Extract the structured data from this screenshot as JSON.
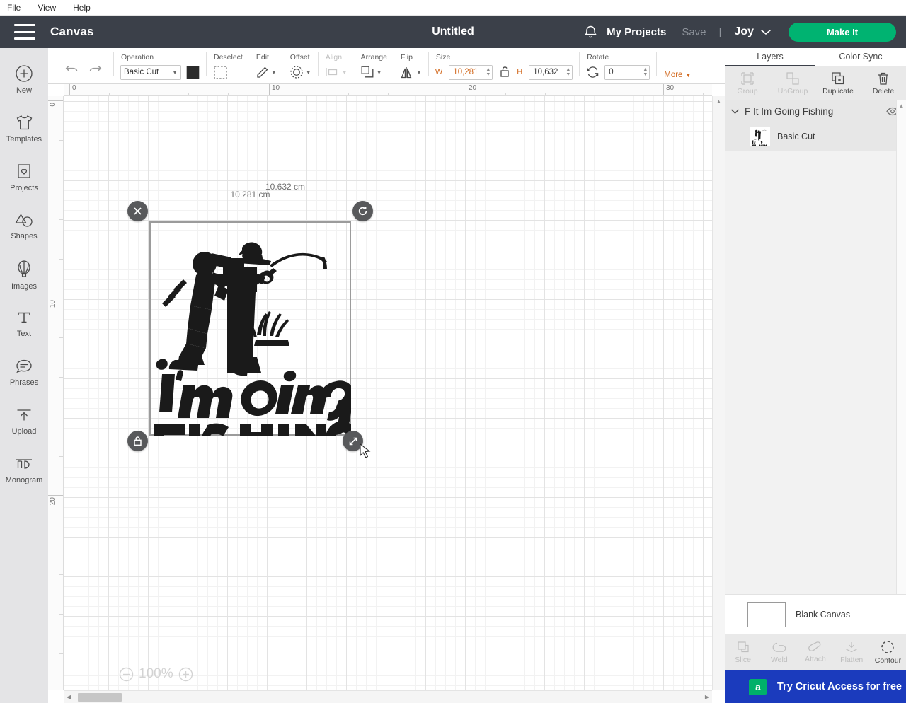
{
  "menubar": {
    "items": [
      {
        "label": "File",
        "name": "menu-file"
      },
      {
        "label": "View",
        "name": "menu-view"
      },
      {
        "label": "Help",
        "name": "menu-help"
      }
    ]
  },
  "header": {
    "hamburger_icon": "hamburger-menu-icon",
    "section_title": "Canvas",
    "document_title": "Untitled",
    "bell_icon": "notification-bell-icon",
    "my_projects_label": "My Projects",
    "save_label": "Save",
    "separator": "|",
    "machine_name": "Joy",
    "machine_caret_icon": "chevron-down-icon",
    "make_it_label": "Make It",
    "make_it_color": "#00b371",
    "background_color": "#3b4049"
  },
  "sidebar": {
    "items": [
      {
        "label": "New",
        "icon": "plus-circle-icon",
        "name": "sidebar-item-new"
      },
      {
        "label": "Templates",
        "icon": "tshirt-icon",
        "name": "sidebar-item-templates"
      },
      {
        "label": "Projects",
        "icon": "clipboard-heart-icon",
        "name": "sidebar-item-projects"
      },
      {
        "label": "Shapes",
        "icon": "shapes-icon",
        "name": "sidebar-item-shapes"
      },
      {
        "label": "Images",
        "icon": "hot-air-balloon-icon",
        "name": "sidebar-item-images"
      },
      {
        "label": "Text",
        "icon": "text-t-icon",
        "name": "sidebar-item-text"
      },
      {
        "label": "Phrases",
        "icon": "speech-bubble-icon",
        "name": "sidebar-item-phrases"
      },
      {
        "label": "Upload",
        "icon": "upload-arrow-icon",
        "name": "sidebar-item-upload"
      },
      {
        "label": "Monogram",
        "icon": "monogram-icon",
        "name": "sidebar-item-monogram"
      }
    ]
  },
  "toolbar": {
    "undo_icon": "undo-arrow-icon",
    "redo_icon": "redo-arrow-icon",
    "operation_label": "Operation",
    "operation_value": "Basic Cut",
    "operation_color": "#2b2b2b",
    "deselect_label": "Deselect",
    "deselect_icon": "deselect-icon",
    "edit_label": "Edit",
    "edit_icon": "pencil-icon",
    "offset_label": "Offset",
    "offset_icon": "offset-icon",
    "align_label": "Align",
    "align_icon": "align-icon",
    "arrange_label": "Arrange",
    "arrange_icon": "arrange-layers-icon",
    "flip_label": "Flip",
    "flip_icon": "flip-icon",
    "size_label": "Size",
    "width_axis": "W",
    "width_value": "10,281",
    "height_axis": "H",
    "height_value": "10,632",
    "lock_icon": "unlocked-padlock-icon",
    "rotate_label": "Rotate",
    "rotate_icon": "rotate-icon",
    "rotate_value": "0",
    "more_label": "More",
    "more_icon": "chevron-down-icon"
  },
  "canvas": {
    "h_ruler_ticks": [
      "0",
      "10",
      "20",
      "30"
    ],
    "v_ruler_ticks": [
      "0",
      "10",
      "20"
    ],
    "zoom_level": "100%",
    "zoom_out_icon": "minus-circle-icon",
    "zoom_in_icon": "plus-circle-icon",
    "selection": {
      "width_label": "10.281 cm",
      "height_label": "10.632 cm",
      "delete_icon": "close-x-icon",
      "rotate_icon": "rotate-handle-icon",
      "lock_icon": "locked-padlock-icon",
      "resize_icon": "resize-diagonal-icon",
      "artwork_title": "F It Im Going Fishing",
      "artwork_text_line1": "I'm Going",
      "artwork_text_line2": "FISHING",
      "artwork_color": "#1a1a1a"
    },
    "scroll_left_icon": "triangle-left-icon",
    "scroll_right_icon": "triangle-right-icon",
    "scroll_up_icon": "triangle-up-icon"
  },
  "right_panel": {
    "tabs": [
      {
        "label": "Layers",
        "name": "tab-layers",
        "active": true
      },
      {
        "label": "Color Sync",
        "name": "tab-color-sync",
        "active": false
      }
    ],
    "operations": [
      {
        "label": "Group",
        "icon": "group-icon",
        "enabled": false,
        "name": "group-button"
      },
      {
        "label": "UnGroup",
        "icon": "ungroup-icon",
        "enabled": false,
        "name": "ungroup-button"
      },
      {
        "label": "Duplicate",
        "icon": "duplicate-icon",
        "enabled": true,
        "name": "duplicate-button"
      },
      {
        "label": "Delete",
        "icon": "trash-icon",
        "enabled": true,
        "name": "delete-button"
      }
    ],
    "layer_group": {
      "name": "F It Im Going Fishing",
      "expand_icon": "chevron-down-icon",
      "visibility_icon": "eye-icon"
    },
    "layer_child": {
      "name": "Basic Cut",
      "thumbnail": "fishing-artwork-thumbnail"
    },
    "canvas_row": {
      "label": "Blank Canvas",
      "swatch_color": "#ffffff"
    },
    "bottom_ops": [
      {
        "label": "Slice",
        "icon": "slice-icon",
        "enabled": false,
        "name": "slice-button"
      },
      {
        "label": "Weld",
        "icon": "weld-icon",
        "enabled": false,
        "name": "weld-button"
      },
      {
        "label": "Attach",
        "icon": "attach-paperclip-icon",
        "enabled": false,
        "name": "attach-button"
      },
      {
        "label": "Flatten",
        "icon": "flatten-icon",
        "enabled": false,
        "name": "flatten-button"
      },
      {
        "label": "Contour",
        "icon": "contour-dashed-circle-icon",
        "enabled": true,
        "name": "contour-button"
      }
    ],
    "promo": {
      "text": "Try Cricut Access for free",
      "badge": "a",
      "background_color": "#1b3bbd"
    }
  }
}
